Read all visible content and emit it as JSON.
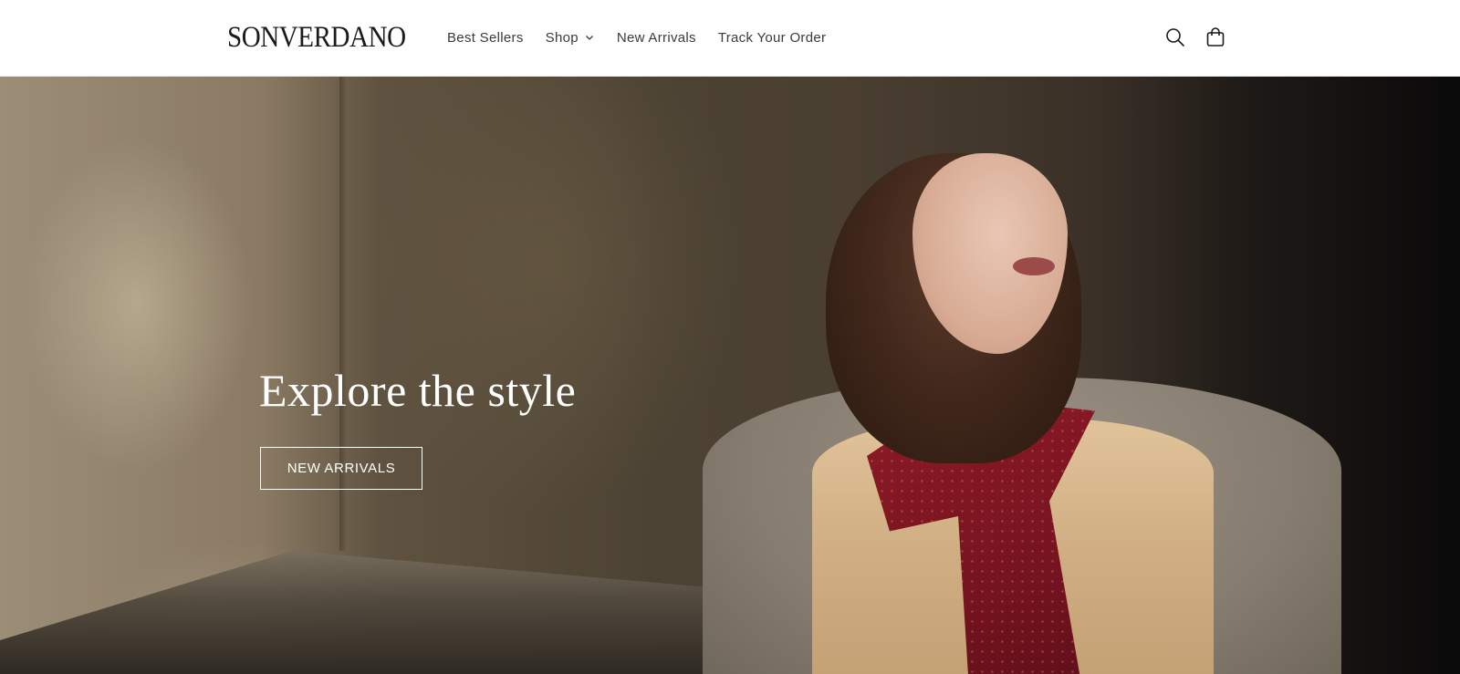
{
  "header": {
    "logo": "SONVERDANO",
    "nav": [
      {
        "label": "Best Sellers"
      },
      {
        "label": "Shop",
        "has_dropdown": true
      },
      {
        "label": "New Arrivals"
      },
      {
        "label": "Track Your Order"
      }
    ],
    "icons": [
      "search-icon",
      "cart-icon"
    ]
  },
  "hero": {
    "title": "Explore the style",
    "button_label": "NEW ARRIVALS"
  },
  "colors": {
    "text_dark": "#1a1a1a",
    "nav_text": "#3a3a3a",
    "hero_text": "#ffffff",
    "scarf": "#8e1a26"
  }
}
